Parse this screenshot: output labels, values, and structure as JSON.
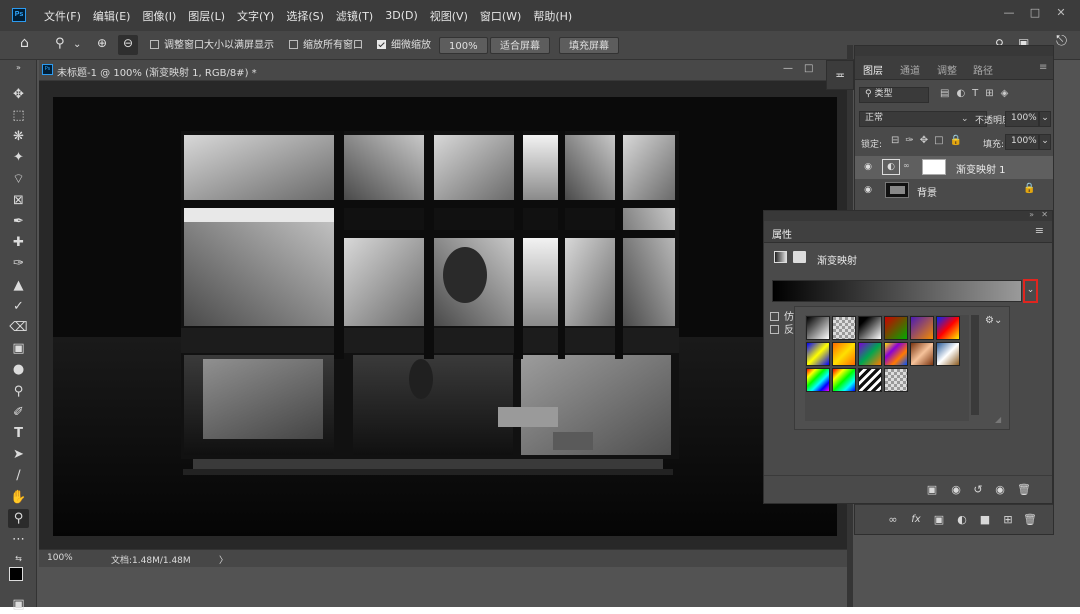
{
  "app": {
    "logo": "Ps"
  },
  "menu": [
    "文件(F)",
    "编辑(E)",
    "图像(I)",
    "图层(L)",
    "文字(Y)",
    "选择(S)",
    "滤镜(T)",
    "3D(D)",
    "视图(V)",
    "窗口(W)",
    "帮助(H)"
  ],
  "window_controls": [
    "minimize-icon",
    "maximize-icon",
    "close-icon"
  ],
  "options": {
    "resize_windows_label": "调整窗口大小以满屏显示",
    "resize_windows_checked": false,
    "zoom_all_label": "缩放所有窗口",
    "zoom_all_checked": false,
    "scrubby_label": "细微缩放",
    "scrubby_checked": true,
    "zoom_100": "100%",
    "fit_screen": "适合屏幕",
    "fill_screen": "填充屏幕"
  },
  "document": {
    "title": "未标题-1 @ 100% (渐变映射 1, RGB/8#) *"
  },
  "status": {
    "zoom": "100%",
    "doc_info": "文档:1.48M/1.48M",
    "arrow": "〉"
  },
  "layers_panel": {
    "tabs": [
      "图层",
      "通道",
      "调整",
      "路径"
    ],
    "filter_kind": "类型",
    "blend_mode": "正常",
    "opacity_label": "不透明度:",
    "opacity_value": "100%",
    "lock_label": "锁定:",
    "fill_label": "填充:",
    "fill_value": "100%",
    "layers": [
      {
        "name": "渐变映射 1",
        "type": "adjustment",
        "visible": true,
        "selected": true
      },
      {
        "name": "背景",
        "type": "image",
        "visible": true,
        "locked": true
      }
    ],
    "footer_icons": [
      "link-icon",
      "fx-icon",
      "mask-icon",
      "adjustment-icon",
      "folder-icon",
      "new-layer-icon",
      "trash-icon"
    ]
  },
  "properties_panel": {
    "title": "属性",
    "subtitle": "渐变映射",
    "dither_label": "仿",
    "reverse_label": "反",
    "footer_icons": [
      "clip-icon",
      "view-previous-icon",
      "reset-icon",
      "visibility-icon",
      "trash-icon"
    ]
  },
  "gradient_presets": [
    {
      "name": "foreground-to-background",
      "css": "linear-gradient(135deg,#000,#fff)"
    },
    {
      "name": "foreground-to-transparent",
      "css": "repeating-conic-gradient(#ddd 0 25%,#999 0 50%) 0 0/6px 6px"
    },
    {
      "name": "black-white",
      "css": "linear-gradient(135deg,#000 20%,#fff)"
    },
    {
      "name": "red-green",
      "css": "linear-gradient(135deg,#c00,#0a0)"
    },
    {
      "name": "violet-orange",
      "css": "linear-gradient(135deg,#4a1bb5,#f38a00)"
    },
    {
      "name": "blue-red-yellow",
      "css": "linear-gradient(135deg,#0026ff,#ff0000,#ffee00)"
    },
    {
      "name": "blue-yellow-blue",
      "css": "linear-gradient(135deg,#0000ff,#ffff00,#0000ff)"
    },
    {
      "name": "orange-yellow-orange",
      "css": "linear-gradient(135deg,#ff6a00,#ffe000,#ff6a00)"
    },
    {
      "name": "violet-green-orange",
      "css": "linear-gradient(135deg,#7a00d6,#00a651,#ff7a00)"
    },
    {
      "name": "yellow-violet-orange-blue",
      "css": "linear-gradient(135deg,#ffe600,#8a00d6,#ff7a00,#0050ff)"
    },
    {
      "name": "copper",
      "css": "linear-gradient(135deg,#7a3410,#f5c29a,#7a3410)"
    },
    {
      "name": "chrome",
      "css": "linear-gradient(135deg,#2a5c9a,#fff,#8a5a20)"
    },
    {
      "name": "spectrum",
      "css": "linear-gradient(135deg,#f00,#ff0,#0f0,#0ff,#00f,#f0f)"
    },
    {
      "name": "transparent-rainbow",
      "css": "linear-gradient(135deg,#f00,#ff0,#0f0,#0ff,#00f)"
    },
    {
      "name": "transparent-stripes",
      "css": "repeating-linear-gradient(135deg,#111 0 3px,#fff 3px 6px)"
    },
    {
      "name": "neutral-density",
      "css": "repeating-conic-gradient(#ddd 0 25%,#999 0 50%) 0 0/6px 6px"
    }
  ]
}
